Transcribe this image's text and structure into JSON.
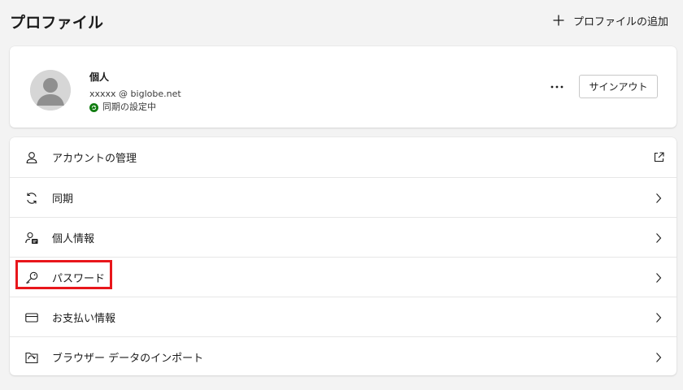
{
  "header": {
    "title": "プロファイル",
    "add_profile_label": "プロファイルの追加"
  },
  "profile": {
    "name": "個人",
    "email": "xxxxx @ biglobe.net",
    "sync_status": "同期の設定中",
    "signout_label": "サインアウト",
    "more_label": "…"
  },
  "menu": {
    "items": [
      {
        "label": "アカウントの管理",
        "icon": "person-icon",
        "trailing": "external-link-icon"
      },
      {
        "label": "同期",
        "icon": "sync-icon",
        "trailing": "chevron-right-icon"
      },
      {
        "label": "個人情報",
        "icon": "personal-info-icon",
        "trailing": "chevron-right-icon"
      },
      {
        "label": "パスワード",
        "icon": "key-icon",
        "trailing": "chevron-right-icon"
      },
      {
        "label": "お支払い情報",
        "icon": "credit-card-icon",
        "trailing": "chevron-right-icon"
      },
      {
        "label": "ブラウザー データのインポート",
        "icon": "import-icon",
        "trailing": "chevron-right-icon"
      }
    ]
  },
  "colors": {
    "background": "#f3f3f3",
    "card": "#ffffff",
    "sync_green": "#107c10",
    "highlight_red": "#e8161b"
  }
}
